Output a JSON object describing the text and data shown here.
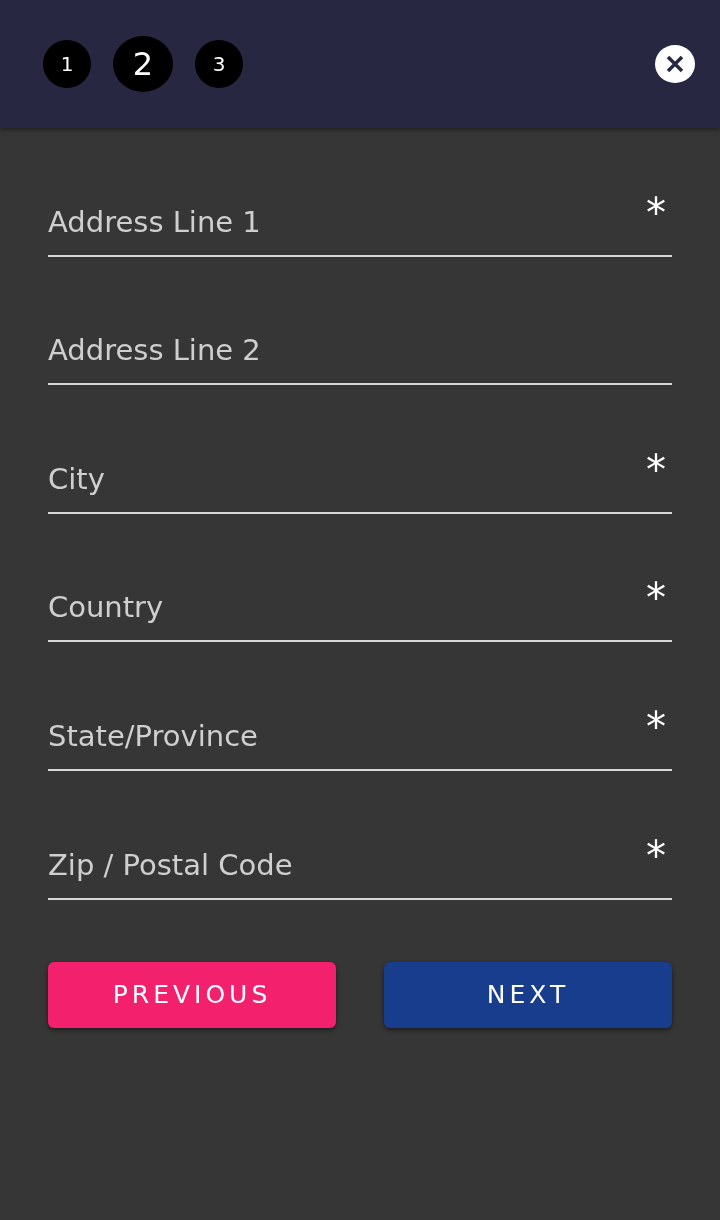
{
  "steps": [
    {
      "label": "1",
      "selected": false
    },
    {
      "label": "2",
      "selected": true
    },
    {
      "label": "3",
      "selected": false
    }
  ],
  "fields": [
    {
      "placeholder": "Address Line 1",
      "required_mark": "*"
    },
    {
      "placeholder": "Address Line 2"
    },
    {
      "placeholder": "City",
      "required_mark": "*"
    },
    {
      "placeholder": "Country",
      "required_mark": "*"
    },
    {
      "placeholder": "State/Province",
      "required_mark": "*"
    },
    {
      "placeholder": "Zip / Postal Code",
      "required_mark": "*"
    }
  ],
  "buttons": [
    {
      "label": "PREVIOUS",
      "kind": "secondary"
    },
    {
      "label": "NEXT",
      "kind": "primary"
    }
  ]
}
